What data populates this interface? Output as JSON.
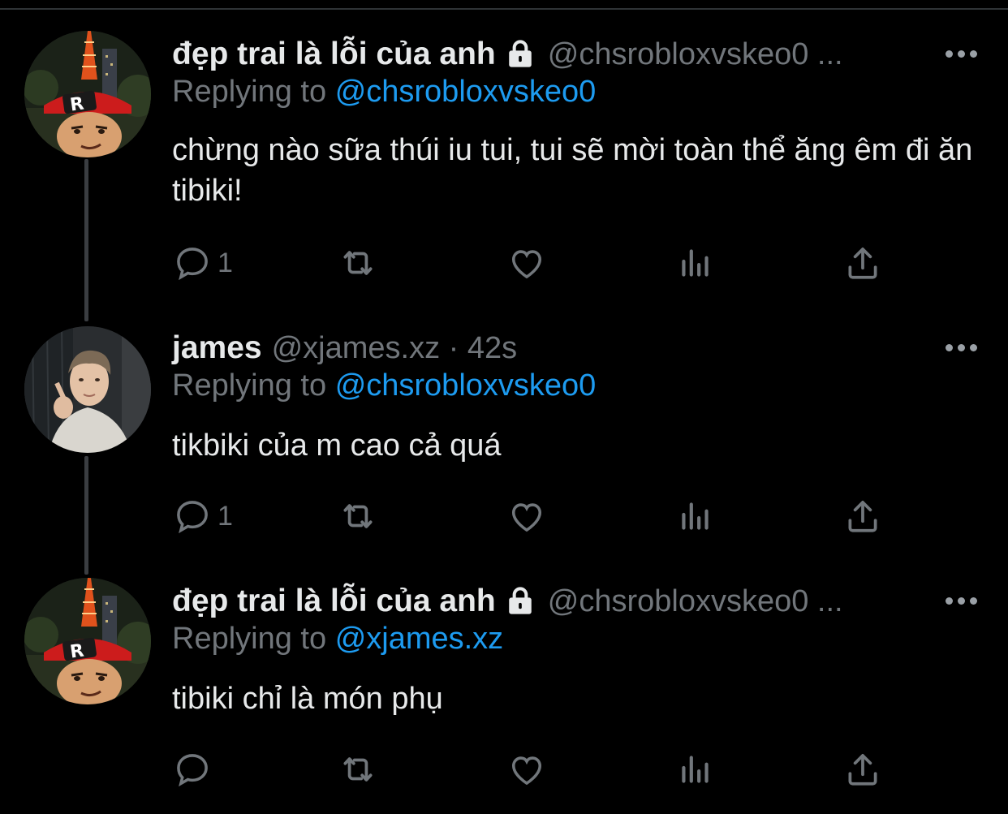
{
  "tweets": [
    {
      "name": "đẹp trai là lỗi của anh",
      "handle": "@chsrobloxvskeo0 ...",
      "replying_prefix": "Replying to",
      "replying_to": "@chsrobloxvskeo0",
      "text": "chừng nào sữa thúi iu tui, tui sẽ mời toàn thể ăng êm đi ăn tibiki!",
      "reply_count": "1",
      "locked": true
    },
    {
      "name": "james",
      "handle": "@xjames.xz · 42s",
      "replying_prefix": "Replying to",
      "replying_to": "@chsrobloxvskeo0",
      "text": "tikbiki của m cao cả quá",
      "reply_count": "1",
      "locked": false
    },
    {
      "name": "đẹp trai là lỗi của anh",
      "handle": "@chsrobloxvskeo0 ...",
      "replying_prefix": "Replying to",
      "replying_to": "@xjames.xz",
      "text": "tibiki chỉ là món phụ",
      "reply_count": "",
      "locked": true
    }
  ],
  "icons": {
    "reply": "reply-icon",
    "retweet": "retweet-icon",
    "like": "heart-icon",
    "views": "analytics-icon",
    "share": "share-icon",
    "more": "more-icon",
    "lock": "lock-icon"
  },
  "colors": {
    "background": "#000000",
    "text": "#e7e9ea",
    "muted": "#71767b",
    "link": "#1d9bf0"
  }
}
